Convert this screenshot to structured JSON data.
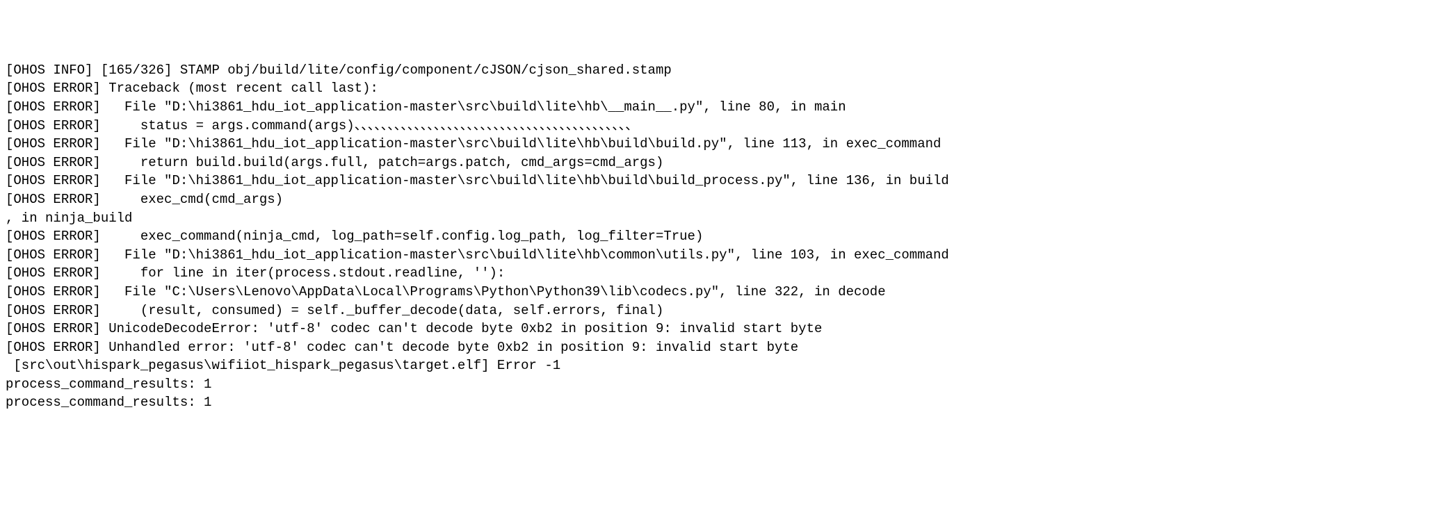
{
  "lines": [
    "[OHOS INFO] [165/326] STAMP obj/build/lite/config/component/cJSON/cjson_shared.stamp",
    "[OHOS ERROR] Traceback (most recent call last):",
    "[OHOS ERROR]   File \"D:\\hi3861_hdu_iot_application-master\\src\\build\\lite\\hb\\__main__.py\", line 80, in main",
    "[OHOS ERROR]     status = args.command(args)、、、、、、、、、、、、、、、、、、、、、、、、、、、、、、、、、、、、、、、、、、",
    "[OHOS ERROR]   File \"D:\\hi3861_hdu_iot_application-master\\src\\build\\lite\\hb\\build\\build.py\", line 113, in exec_command",
    "[OHOS ERROR]     return build.build(args.full, patch=args.patch, cmd_args=cmd_args)",
    "[OHOS ERROR]   File \"D:\\hi3861_hdu_iot_application-master\\src\\build\\lite\\hb\\build\\build_process.py\", line 136, in build",
    "[OHOS ERROR]     exec_cmd(cmd_args)",
    ", in ninja_build",
    "[OHOS ERROR]     exec_command(ninja_cmd, log_path=self.config.log_path, log_filter=True)",
    "[OHOS ERROR]   File \"D:\\hi3861_hdu_iot_application-master\\src\\build\\lite\\hb\\common\\utils.py\", line 103, in exec_command",
    "[OHOS ERROR]     for line in iter(process.stdout.readline, ''):",
    "[OHOS ERROR]   File \"C:\\Users\\Lenovo\\AppData\\Local\\Programs\\Python\\Python39\\lib\\codecs.py\", line 322, in decode",
    "[OHOS ERROR]     (result, consumed) = self._buffer_decode(data, self.errors, final)",
    "[OHOS ERROR] UnicodeDecodeError: 'utf-8' codec can't decode byte 0xb2 in position 9: invalid start byte",
    "[OHOS ERROR] Unhandled error: 'utf-8' codec can't decode byte 0xb2 in position 9: invalid start byte",
    " [src\\out\\hispark_pegasus\\wifiiot_hispark_pegasus\\target.elf] Error -1",
    "process_command_results: 1",
    "process_command_results: 1"
  ]
}
